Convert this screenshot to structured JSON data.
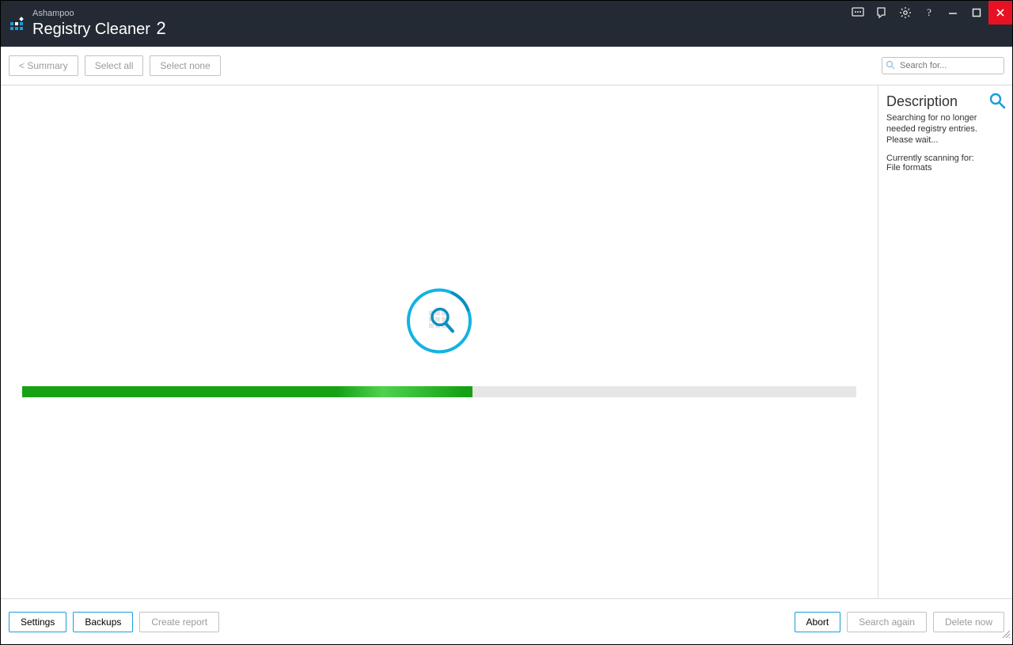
{
  "titlebar": {
    "brand": "Ashampoo",
    "app_name": "Registry Cleaner",
    "version": "2"
  },
  "toolbar": {
    "summary_label": "< Summary",
    "select_all_label": "Select all",
    "select_none_label": "Select none",
    "search_placeholder": "Search for..."
  },
  "sidebar": {
    "title": "Description",
    "status_text": "Searching for no longer needed registry entries. Please wait...",
    "scanning_label": "Currently scanning for:",
    "scanning_value": "File formats"
  },
  "progress": {
    "percent": 54
  },
  "footer": {
    "settings_label": "Settings",
    "backups_label": "Backups",
    "create_report_label": "Create report",
    "abort_label": "Abort",
    "search_again_label": "Search again",
    "delete_now_label": "Delete now"
  }
}
